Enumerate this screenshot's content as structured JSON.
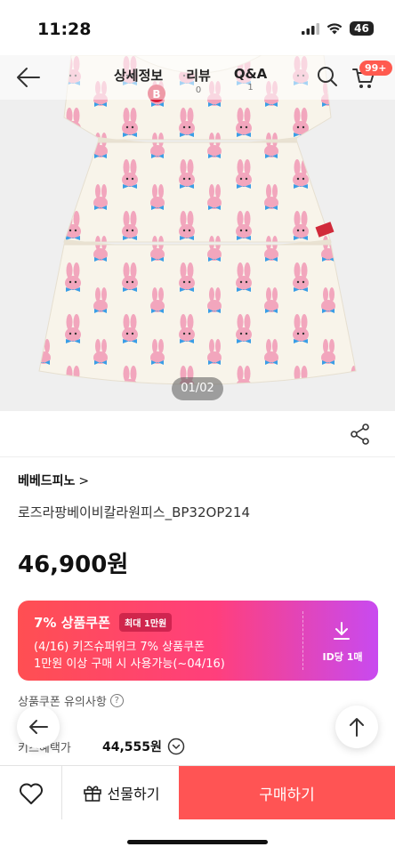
{
  "status_bar": {
    "time": "11:28",
    "battery": "46",
    "icons": [
      "signal-icon",
      "wifi-icon",
      "battery-icon"
    ]
  },
  "nav": {
    "tabs": [
      {
        "label": "상세정보",
        "count": ""
      },
      {
        "label": "리뷰",
        "count": "0"
      },
      {
        "label": "Q&A",
        "count": "1"
      }
    ],
    "cart_badge": "99+",
    "icons": [
      "back-arrow-icon",
      "search-icon",
      "cart-icon"
    ]
  },
  "gallery": {
    "counter": "01/02",
    "image": "product-dress-photo"
  },
  "product": {
    "brand": "베베드피노",
    "brand_chevron": ">",
    "name": "로즈라팡베이비칼라원피스_BP32OP214",
    "price": "46,900원"
  },
  "coupon": {
    "title": "7% 상품쿠폰",
    "max_badge": "최대 1만원",
    "desc_line1": "(4/16) 키즈슈퍼위크 7% 상품쿠폰",
    "desc_line2": "1만원 이상 구매 시 사용가능(~04/16)",
    "limit": "ID당 1매",
    "colors": {
      "start": "#ff4f52",
      "mid": "#ff3f7c",
      "end": "#c84af0"
    }
  },
  "coupon_notice": {
    "label": "상품쿠폰 유의사항",
    "help_glyph": "?"
  },
  "kids_price": {
    "label": "키즈혜택가",
    "value": "44,555원"
  },
  "bottom_bar": {
    "gift_label": "선물하기",
    "buy_label": "구매하기",
    "buy_color": "#ff5454"
  }
}
